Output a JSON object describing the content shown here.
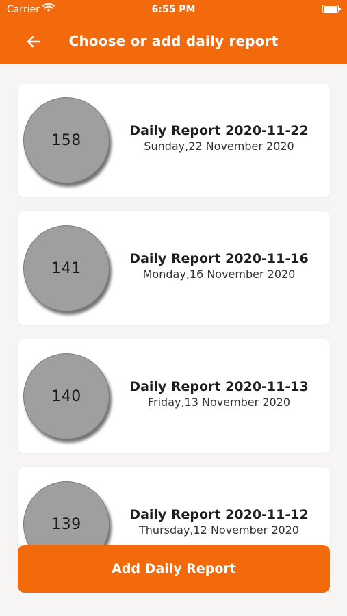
{
  "status_bar": {
    "carrier": "Carrier",
    "time": "6:55 PM"
  },
  "header": {
    "title": "Choose or add daily report",
    "back_icon": "arrow-left-icon"
  },
  "reports": [
    {
      "number": "158",
      "title": "Daily Report 2020-11-22",
      "date": "Sunday,22 November 2020"
    },
    {
      "number": "141",
      "title": "Daily Report 2020-11-16",
      "date": "Monday,16 November 2020"
    },
    {
      "number": "140",
      "title": "Daily Report 2020-11-13",
      "date": "Friday,13 November 2020"
    },
    {
      "number": "139",
      "title": "Daily Report 2020-11-12",
      "date": "Thursday,12 November 2020"
    }
  ],
  "add_button": {
    "label": "Add Daily Report"
  },
  "colors": {
    "accent": "#f26a0c",
    "badge": "#9f9f9f",
    "background": "#f6f5f3"
  }
}
